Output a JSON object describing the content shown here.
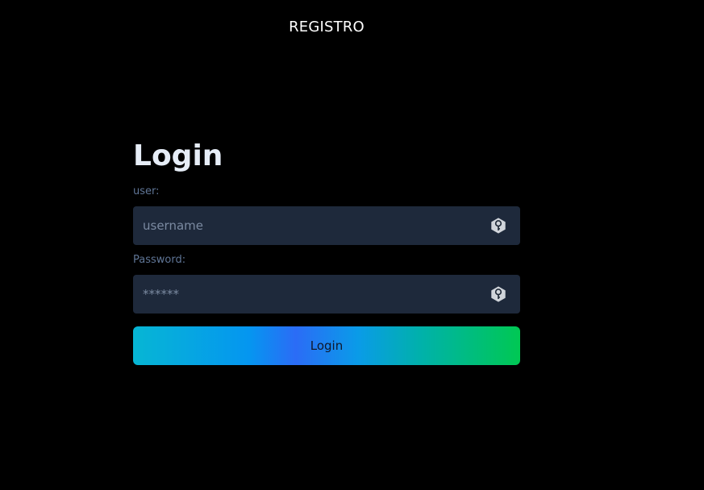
{
  "nav": {
    "register_link": "REGISTRO"
  },
  "login_form": {
    "title": "Login",
    "user_label": "user:",
    "user_placeholder": "username",
    "password_label": "Password:",
    "password_placeholder": "******",
    "submit_label": "Login",
    "field_icon": "key-hexagon-icon"
  },
  "colors": {
    "background": "#000000",
    "field_bg": "#1e293b",
    "label": "#5f7596",
    "button_gradient": [
      "#06b6d4",
      "#2b6cf6",
      "#00c853"
    ]
  }
}
